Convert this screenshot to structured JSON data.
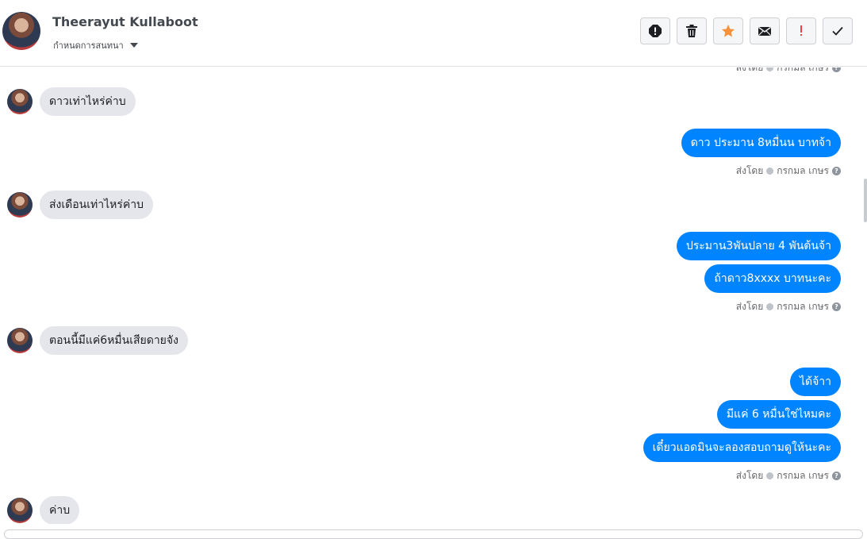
{
  "header": {
    "contact_name": "Theerayut Kullaboot",
    "subtitle": "กำหนดการสนทนา",
    "toolbar": [
      {
        "name": "report-button",
        "icon": "alert-octagon-icon"
      },
      {
        "name": "delete-button",
        "icon": "trash-icon"
      },
      {
        "name": "star-button",
        "icon": "star-icon",
        "color": "#f7923a"
      },
      {
        "name": "mark-unread-button",
        "icon": "envelope-icon"
      },
      {
        "name": "important-button",
        "icon": "exclamation-icon",
        "color": "#fa3e3e"
      },
      {
        "name": "done-button",
        "icon": "checkmark-icon"
      }
    ]
  },
  "thread": {
    "top_sent_label": "ส่งโดย",
    "top_sender": "กรกมล เกษร",
    "messages": [
      {
        "dir": "in",
        "text": "ดาวเท่าไหร่ค่าบ"
      },
      {
        "dir": "out",
        "text": "ดาว ประมาน 8หมื่นน  บาทจ้า"
      },
      {
        "dir": "sent-by",
        "label": "ส่งโดย",
        "sender": "กรกมล เกษร"
      },
      {
        "dir": "in",
        "text": "ส่งเดือนเท่าไหร่ค่าบ"
      },
      {
        "dir": "out",
        "text": "ประมาน3พันปลาย 4 พันต้นจ้า"
      },
      {
        "dir": "out",
        "text": "ถ้าดาว8xxxx บาทนะคะ"
      },
      {
        "dir": "sent-by",
        "label": "ส่งโดย",
        "sender": "กรกมล เกษร"
      },
      {
        "dir": "in",
        "text": "ตอนนี้มีแค่6หมื่นเสียดายจัง"
      },
      {
        "dir": "out",
        "text": "ได้จ้าา"
      },
      {
        "dir": "out",
        "text": "มีแค่ 6 หมื่นใช่ไหมคะ"
      },
      {
        "dir": "out",
        "text": "เดี๋ยวแอดมินจะลองสอบถามดูให้นะคะ"
      },
      {
        "dir": "sent-by",
        "label": "ส่งโดย",
        "sender": "กรกมล เกษร"
      },
      {
        "dir": "in",
        "text": "ค่าบ"
      }
    ]
  },
  "colors": {
    "outgoing_bubble": "#0084ff",
    "incoming_bubble": "#e4e6eb"
  }
}
